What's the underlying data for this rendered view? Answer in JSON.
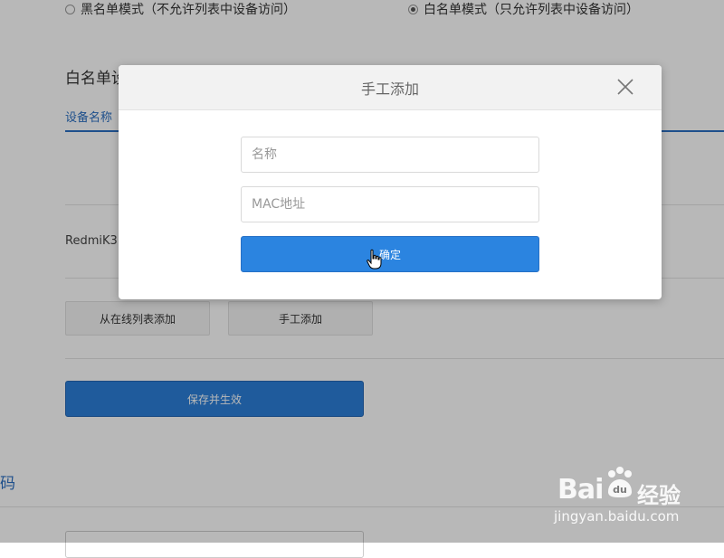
{
  "mode": {
    "blacklist_label": "黑名单模式（不允许列表中设备访问）",
    "whitelist_label": "白名单模式（只允许列表中设备访问）",
    "selected": "whitelist"
  },
  "whitelist": {
    "title": "白名单设",
    "column_device_name": "设备名称",
    "device_partial": "RedmiK3"
  },
  "actions": {
    "add_from_online": "从在线列表添加",
    "manual_add": "手工添加",
    "save": "保存并生效"
  },
  "password_section_label": "码",
  "modal": {
    "title": "手工添加",
    "name_placeholder": "名称",
    "mac_placeholder": "MAC地址",
    "confirm": "确定"
  },
  "watermark": {
    "brand": "Bai",
    "cn": "经验",
    "url": "jingyan.baidu.com"
  },
  "colors": {
    "accent": "#2b84e0",
    "link": "#2b6fc2",
    "overlay": "rgba(0,0,0,0.28)"
  }
}
